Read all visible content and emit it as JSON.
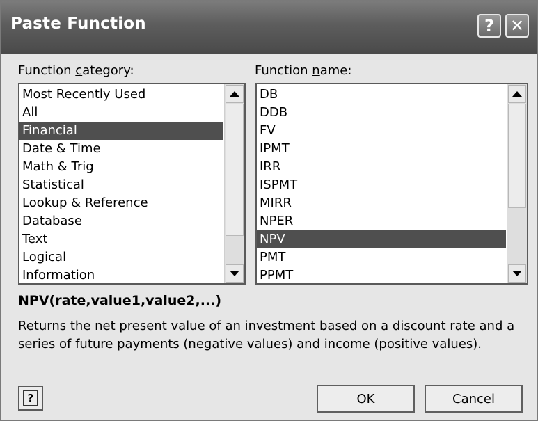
{
  "window": {
    "title": "Paste Function",
    "help_glyph": "?",
    "close_glyph": "✕"
  },
  "category": {
    "label_before": "Function ",
    "label_accel": "c",
    "label_after": "ategory:",
    "items": [
      "Most Recently Used",
      "All",
      "Financial",
      "Date & Time",
      "Math & Trig",
      "Statistical",
      "Lookup & Reference",
      "Database",
      "Text",
      "Logical",
      "Information"
    ],
    "selected": "Financial"
  },
  "function_name": {
    "label_before": "Function ",
    "label_accel": "n",
    "label_after": "ame:",
    "items": [
      "DB",
      "DDB",
      "FV",
      "IPMT",
      "IRR",
      "ISPMT",
      "MIRR",
      "NPER",
      "NPV",
      "PMT",
      "PPMT"
    ],
    "selected": "NPV"
  },
  "signature": "NPV(rate,value1,value2,...)",
  "description": "Returns the net present value of an investment based on a discount rate and a series of future payments (negative values) and income (positive values).",
  "buttons": {
    "help_glyph": "?",
    "ok": "OK",
    "cancel": "Cancel"
  }
}
